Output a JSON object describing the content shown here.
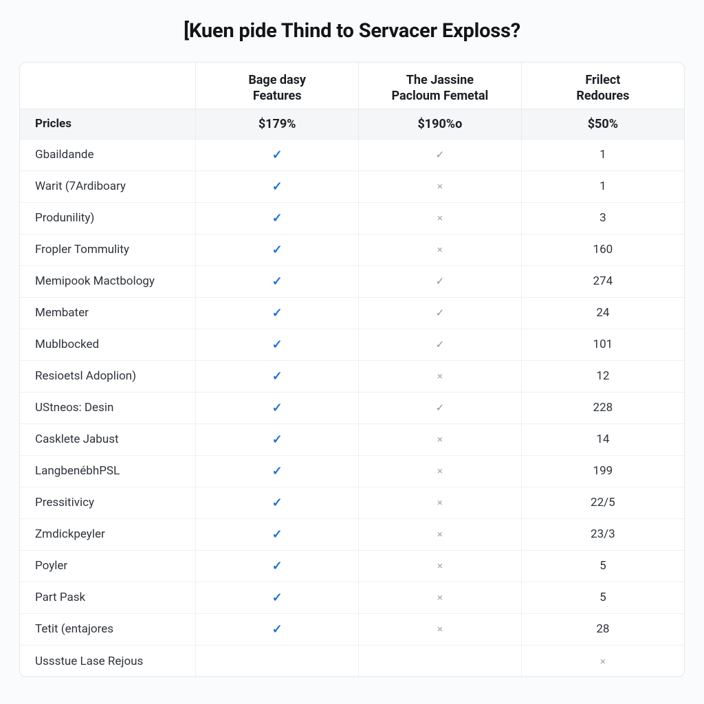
{
  "title": "[Kuen pide Thind to Servacer Exploss?",
  "row_label_header": "Pricles",
  "plans": [
    {
      "name_line1": "Bage dasy",
      "name_line2": "Features",
      "price": "$179%"
    },
    {
      "name_line1": "The Jassine",
      "name_line2": "Pacloum Femetal",
      "price": "$190%o"
    },
    {
      "name_line1": "Frilect",
      "name_line2": "Redoures",
      "price": "$50%"
    }
  ],
  "rows": [
    {
      "label": "Gbaildande",
      "c1": "check-strong",
      "c2": "check-weak",
      "c3": "1"
    },
    {
      "label": "Warit (7Ardiboary",
      "c1": "check-strong",
      "c2": "cross",
      "c3": "1"
    },
    {
      "label": "Produnility)",
      "c1": "check-strong",
      "c2": "cross",
      "c3": "3"
    },
    {
      "label": "Fropler Tommulity",
      "c1": "check-strong",
      "c2": "cross",
      "c3": "160"
    },
    {
      "label": "Memipook Mactbology",
      "c1": "check-strong",
      "c2": "check-weak",
      "c3": "274"
    },
    {
      "label": "Membater",
      "c1": "check-strong",
      "c2": "check-weak",
      "c3": "24"
    },
    {
      "label": "Mublbocked",
      "c1": "check-strong",
      "c2": "check-weak",
      "c3": "101"
    },
    {
      "label": "Resioetsl Adoplion)",
      "c1": "check-strong",
      "c2": "cross",
      "c3": "12"
    },
    {
      "label": "UStneos: Desin",
      "c1": "check-strong",
      "c2": "check-weak",
      "c3": "228"
    },
    {
      "label": "Casklete Jabust",
      "c1": "check-strong",
      "c2": "cross",
      "c3": "14"
    },
    {
      "label": "LangbenébhPSL",
      "c1": "check-strong",
      "c2": "cross",
      "c3": "199"
    },
    {
      "label": "Pressitivicy",
      "c1": "check-strong",
      "c2": "cross",
      "c3": "22/5"
    },
    {
      "label": "Zmdickpeyler",
      "c1": "check-strong",
      "c2": "cross",
      "c3": "23/3"
    },
    {
      "label": "Poyler",
      "c1": "check-strong",
      "c2": "cross",
      "c3": "5"
    },
    {
      "label": "Part Pask",
      "c1": "check-strong",
      "c2": "cross",
      "c3": "5"
    },
    {
      "label": "Tetit (entajores",
      "c1": "check-strong",
      "c2": "cross",
      "c3": "28"
    },
    {
      "label": "Ussstue Lase Rejous",
      "c1": "",
      "c2": "",
      "c3": "cross"
    }
  ],
  "glyphs": {
    "check-strong": "✓",
    "check-weak": "✓",
    "cross": "×"
  }
}
